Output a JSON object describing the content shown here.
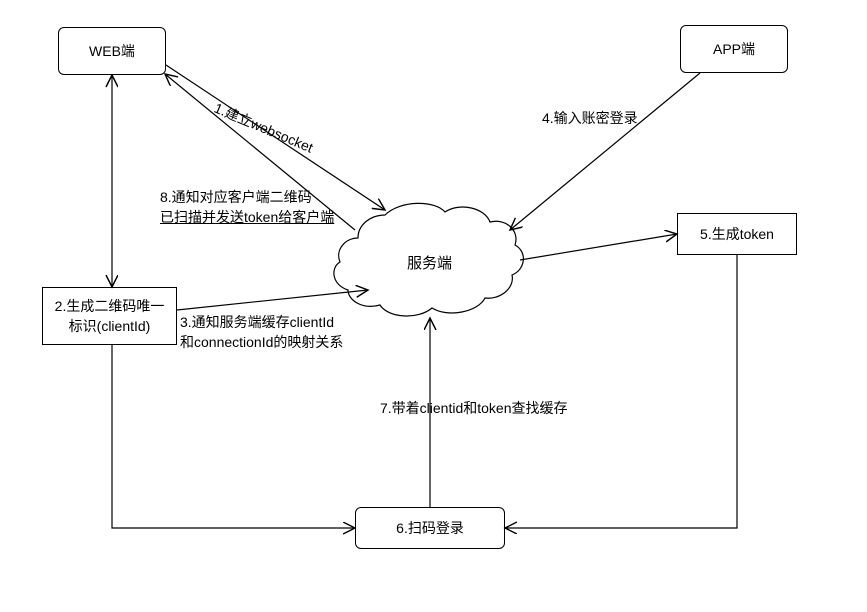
{
  "nodes": {
    "web": "WEB端",
    "app": "APP端",
    "server": "服务端",
    "step2": "2.生成二维码唯一标识(clientId)",
    "step5": "5.生成token",
    "step6": "6.扫码登录"
  },
  "edges": {
    "e1": "1.建立websocket",
    "e3_line1": "3.通知服务端缓存clientId",
    "e3_line2": "和connectionId的映射关系",
    "e4": "4.输入账密登录",
    "e7": "7.带着clientid和token查找缓存",
    "e8_line1": "8.通知对应客户端二维码",
    "e8_line2": "已扫描并发送token给客户端"
  }
}
